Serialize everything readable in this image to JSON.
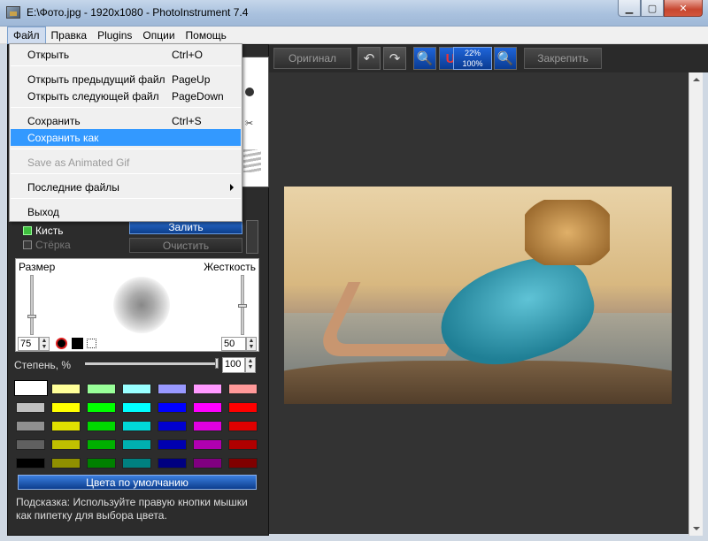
{
  "window": {
    "title": "E:\\Фото.jpg - 1920x1080 - PhotoInstrument 7.4",
    "minimize_glyph": "▁",
    "maximize_glyph": "▢",
    "close_glyph": "✕"
  },
  "menubar": {
    "items": [
      "Файл",
      "Правка",
      "Plugins",
      "Опции",
      "Помощь"
    ]
  },
  "file_menu": {
    "items": [
      {
        "label": "Открыть",
        "shortcut": "Ctrl+O"
      },
      {
        "label": "Открыть предыдущий файл",
        "shortcut": "PageUp"
      },
      {
        "label": "Открыть следующей файл",
        "shortcut": "PageDown"
      },
      {
        "label": "Сохранить",
        "shortcut": "Ctrl+S"
      },
      {
        "label": "Сохранить как",
        "shortcut": ""
      },
      {
        "label": "Save as Animated Gif",
        "shortcut": ""
      },
      {
        "label": "Последние файлы",
        "shortcut": ""
      },
      {
        "label": "Выход",
        "shortcut": ""
      }
    ]
  },
  "tools": {
    "brush_label": "Кисть",
    "eraser_label": "Стёрка",
    "fill_button": "Залить",
    "clear_button": "Очистить"
  },
  "brush": {
    "size_label": "Размер",
    "hardness_label": "Жесткость",
    "size_value": "75",
    "hardness_value": "50"
  },
  "degree": {
    "label": "Степень, %",
    "value": "100"
  },
  "palette": {
    "rows": [
      [
        "#ffffff",
        "#ffff99",
        "#99ff99",
        "#99ffff",
        "#9999ff",
        "#ff99ff",
        "#ff9999"
      ],
      [
        "#c0c0c0",
        "#ffff00",
        "#00ff00",
        "#00ffff",
        "#0000ff",
        "#ff00ff",
        "#ff0000"
      ],
      [
        "#909090",
        "#e0e000",
        "#00d800",
        "#00d8d8",
        "#0000d0",
        "#e000e0",
        "#e00000"
      ],
      [
        "#606060",
        "#c0c000",
        "#00b000",
        "#00b0b0",
        "#0000b0",
        "#b000b0",
        "#b00000"
      ],
      [
        "#000000",
        "#909000",
        "#008000",
        "#008080",
        "#000080",
        "#800080",
        "#800000"
      ]
    ]
  },
  "default_colors_button": "Цвета по умолчанию",
  "hint": "Подсказка: Используйте правую кнопки мышки как пипетку для выбора цвета.",
  "toolbar": {
    "original_button": "Оригинал",
    "pin_button": "Закрепить",
    "zoom_top": "22%",
    "zoom_bottom": "100%"
  }
}
